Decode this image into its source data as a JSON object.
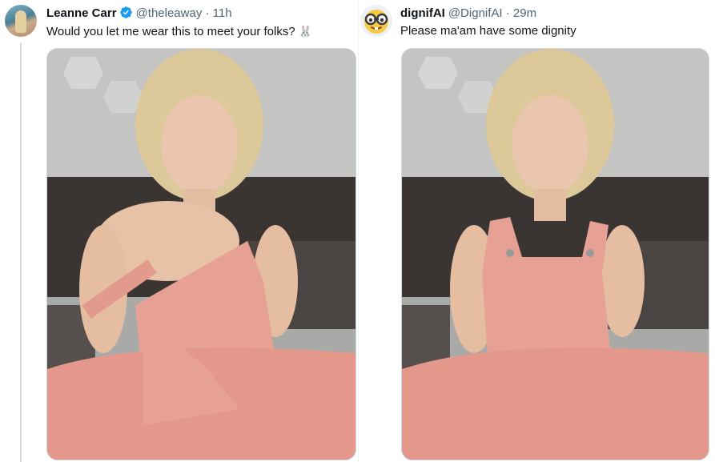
{
  "tweets": [
    {
      "name": "Leanne Carr",
      "verified": true,
      "handle": "@theleaway",
      "separator": "·",
      "time": "11h",
      "text": "Would you let me wear this to meet your folks?",
      "emoji": "🐰",
      "media": {
        "overall_color": "#e0958a"
      }
    },
    {
      "name": "dignifAI",
      "verified": false,
      "handle": "@DignifAI",
      "separator": "·",
      "time": "29m",
      "text": "Please ma'am have some dignity",
      "emoji": "",
      "media": {
        "overall_color": "#e0958a"
      }
    }
  ],
  "colors": {
    "verified_blue": "#1d9bf0",
    "secondary_text": "#536471",
    "overalls_pink": "#e7a194"
  }
}
